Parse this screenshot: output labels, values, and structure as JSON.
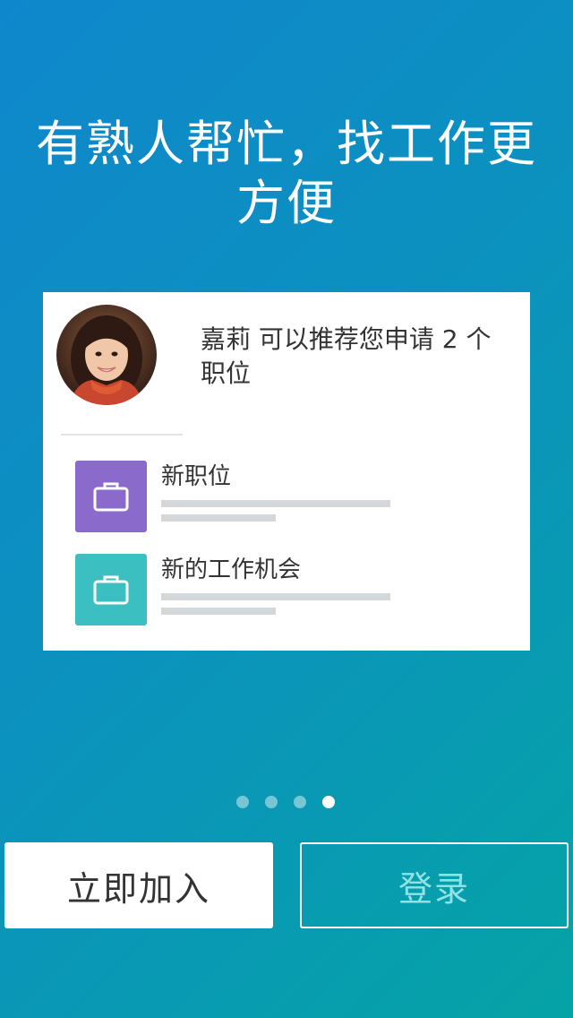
{
  "headline": "有熟人帮忙，找工作更方便",
  "card": {
    "recommendation_text": "嘉莉 可以推荐您申请 2 个职位",
    "avatar_icon": "person-photo",
    "jobs": [
      {
        "title": "新职位",
        "icon": "briefcase-icon",
        "color": "#8a6bcc"
      },
      {
        "title": "新的工作机会",
        "icon": "briefcase-icon",
        "color": "#3bbfc0"
      }
    ]
  },
  "pagination": {
    "total": 4,
    "active_index": 3
  },
  "buttons": {
    "join_label": "立即加入",
    "login_label": "登录"
  },
  "colors": {
    "background_start": "#0f87cc",
    "background_end": "#05a3a6",
    "login_text": "#8fe3e3"
  }
}
